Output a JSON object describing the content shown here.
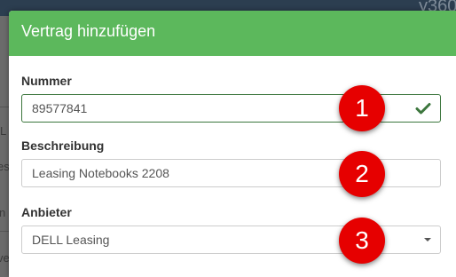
{
  "app": {
    "title_fragment": "y360",
    "side_fragments": [
      "L",
      "es",
      "n",
      "ve"
    ]
  },
  "modal": {
    "title": "Vertrag hinzufügen",
    "header_color": "#5cb85c"
  },
  "fields": {
    "nummer": {
      "label": "Nummer",
      "value": "89577841",
      "state": "valid",
      "icon": "check-icon"
    },
    "beschreibung": {
      "label": "Beschreibung",
      "value": "Leasing Notebooks 2208"
    },
    "anbieter": {
      "label": "Anbieter",
      "selected": "DELL Leasing",
      "icon": "caret-down-icon"
    }
  },
  "markers": [
    "1",
    "2",
    "3"
  ],
  "colors": {
    "marker": "#e60000",
    "valid": "#3c763d"
  }
}
